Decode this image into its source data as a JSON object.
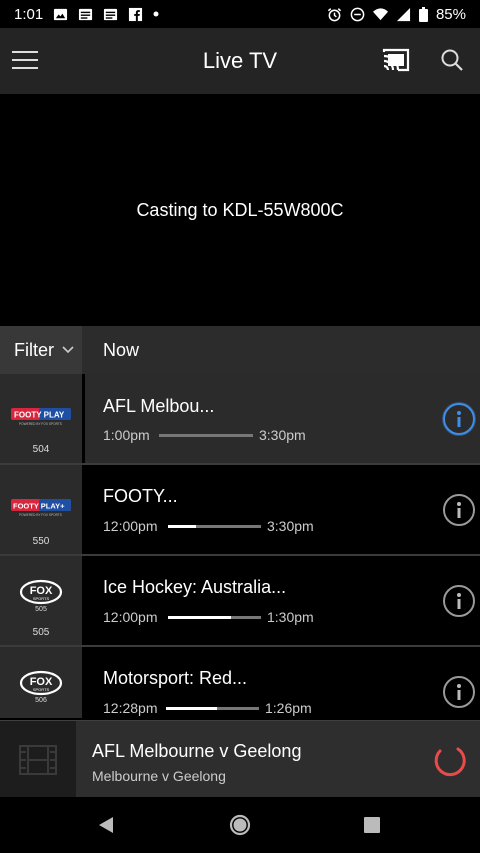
{
  "status_bar": {
    "time": "1:01",
    "battery": "85%"
  },
  "app_bar": {
    "title": "Live TV"
  },
  "player": {
    "casting_text": "Casting to KDL-55W800C"
  },
  "guide": {
    "filter_label": "Filter",
    "now_label": "Now"
  },
  "channels": [
    {
      "logo": "FOOTY PLAY",
      "logo_sub": "POWERED BY FOX SPORTS",
      "number": "504",
      "title": "AFL Melbou...",
      "start": "1:00pm",
      "end": "3:30pm",
      "progress": 0.0,
      "active": true
    },
    {
      "logo": "FOOTY PLAY+",
      "logo_sub": "POWERED BY FOX SPORTS",
      "number": "550",
      "title": "FOOTY...",
      "start": "12:00pm",
      "end": "3:30pm",
      "progress": 0.3,
      "active": false
    },
    {
      "logo": "FOX",
      "logo_sub": "SPORTS",
      "logo_num": "505",
      "number": "505",
      "title": "Ice Hockey: Australia...",
      "start": "12:00pm",
      "end": "1:30pm",
      "progress": 0.68,
      "active": false
    },
    {
      "logo": "FOX",
      "logo_sub": "SPORTS",
      "logo_num": "506",
      "number": "",
      "title": "Motorsport: Red...",
      "start": "12:28pm",
      "end": "1:26pm",
      "progress": 0.55,
      "active": false
    }
  ],
  "mini_player": {
    "title": "AFL Melbourne v Geelong",
    "subtitle": "Melbourne v Geelong"
  },
  "colors": {
    "accent_blue": "#3f8ee8",
    "spinner_red": "#e94b4b"
  }
}
